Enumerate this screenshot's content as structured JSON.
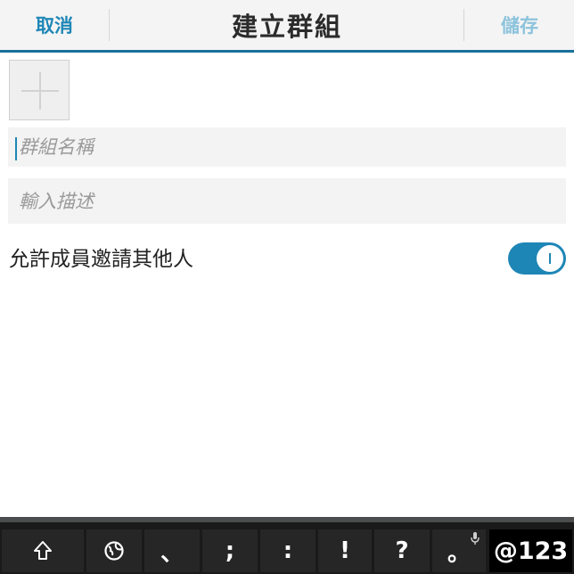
{
  "header": {
    "cancel_label": "取消",
    "title": "建立群組",
    "save_label": "儲存",
    "accent_color": "#1e86b6",
    "save_color_disabled": "#8cc3dc"
  },
  "form": {
    "add_photo_icon": "plus-icon",
    "group_name": {
      "value": "",
      "placeholder": "群組名稱"
    },
    "description": {
      "value": "",
      "placeholder": "輸入描述"
    },
    "allow_invite": {
      "label": "允許成員邀請其他人",
      "enabled": true
    }
  },
  "keyboard": {
    "keys": [
      {
        "name": "shift",
        "icon": "shift-icon"
      },
      {
        "name": "globe",
        "icon": "globe-icon"
      },
      {
        "name": "enumeration-comma",
        "label": "、"
      },
      {
        "name": "semicolon",
        "label": ";"
      },
      {
        "name": "colon",
        "label": ":"
      },
      {
        "name": "exclamation",
        "label": "!"
      },
      {
        "name": "question",
        "label": "?"
      },
      {
        "name": "period",
        "label": "。",
        "secondary_icon": "microphone-icon"
      },
      {
        "name": "symbols",
        "label": "@123"
      }
    ]
  }
}
